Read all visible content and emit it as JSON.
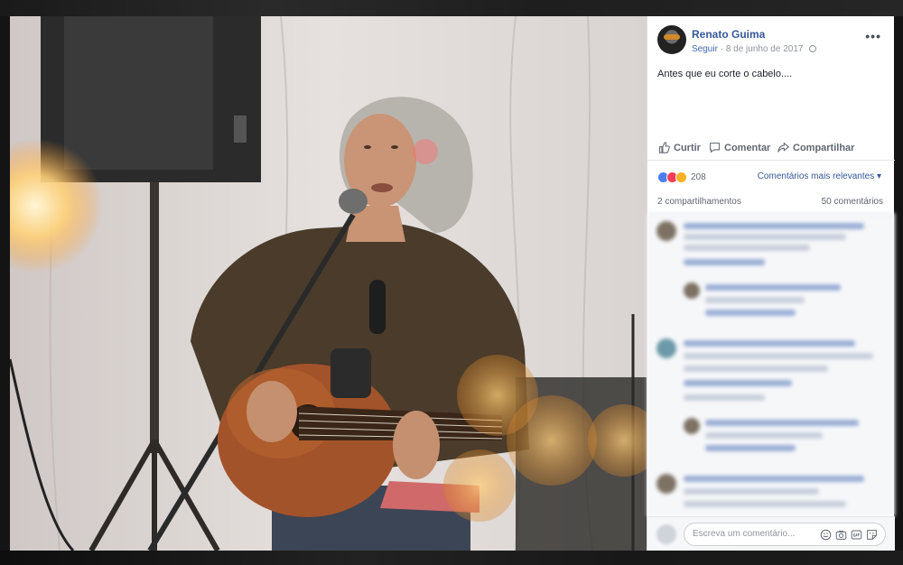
{
  "post": {
    "author": "Renato Guima",
    "follow_label": "Seguir",
    "separator": "·",
    "date": "8 de junho de 2017",
    "text": "Antes que eu corte o cabelo....",
    "more_label": "•••"
  },
  "actions": {
    "like": "Curtir",
    "comment": "Comentar",
    "share": "Compartilhar"
  },
  "reactions": {
    "count": "208",
    "sort_label": "Comentários mais relevantes ▾"
  },
  "stats": {
    "shares": "2 compartilhamentos",
    "comments": "50 comentários"
  },
  "composer": {
    "placeholder": "Escreva um comentário..."
  },
  "icons": [
    "avatar",
    "more-options-icon",
    "globe-icon",
    "like-icon",
    "comment-icon",
    "share-icon",
    "like-reaction-icon",
    "love-reaction-icon",
    "haha-reaction-icon",
    "emoji-icon",
    "camera-icon",
    "gif-icon",
    "sticker-icon"
  ]
}
